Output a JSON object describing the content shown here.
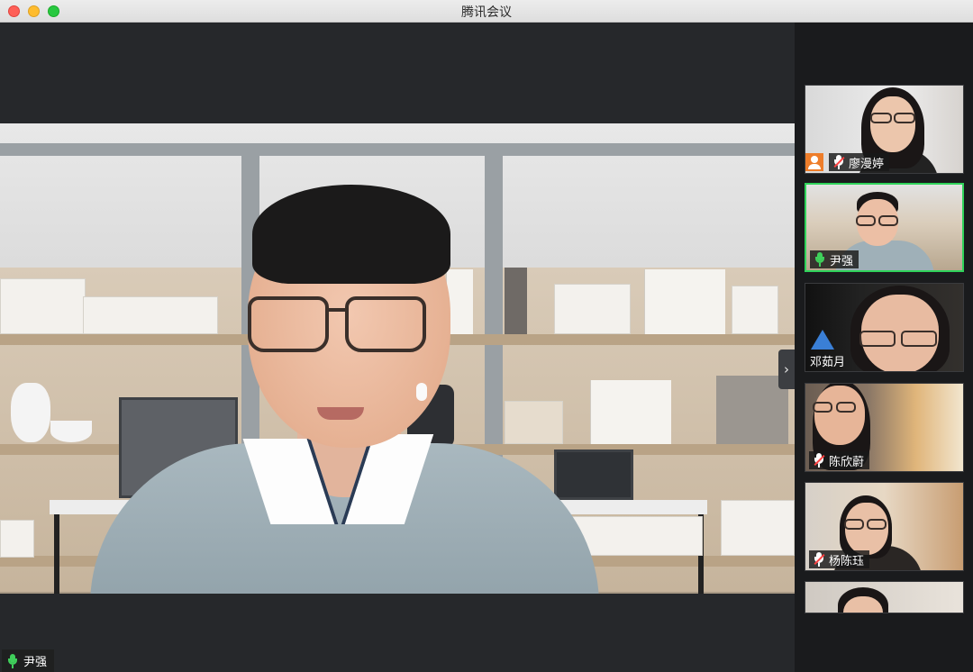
{
  "window": {
    "title": "腾讯会议"
  },
  "main_speaker": {
    "name": "尹强",
    "mic": "on"
  },
  "participants": [
    {
      "name": "廖漫婷",
      "mic": "muted",
      "avatar_badge": "person-icon"
    },
    {
      "name": "尹强",
      "mic": "on",
      "active": true
    },
    {
      "name": "邓茹月",
      "mic": "speaking"
    },
    {
      "name": "陈欣蔚",
      "mic": "muted"
    },
    {
      "name": "杨陈珏",
      "mic": "muted"
    },
    {
      "name": "",
      "mic": ""
    }
  ],
  "colors": {
    "accent_green": "#2fd35a",
    "avatar_orange": "#ee7d2a",
    "speaking_blue": "#3a7fd6"
  },
  "icons": {
    "next": "chevron-right-icon"
  }
}
